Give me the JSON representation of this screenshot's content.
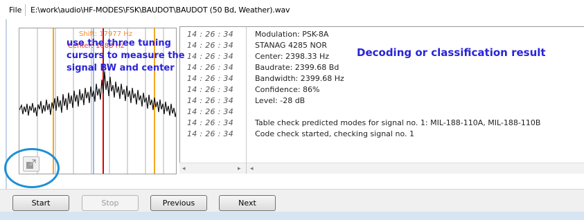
{
  "file_bar": {
    "menu_label": "File",
    "path": "E:\\work\\audio\\HF-MODES\\FSK\\BAUDOT\\BAUDOT (50 Bd, Weather).wav"
  },
  "spectrum": {
    "shift_label": "Shift: 17977 Hz",
    "center_label": "Center: 1088 Hz",
    "annotation": "use the three tuning\ncursors to measure the\nsignal BW and center",
    "colors": {
      "shift_cursor": "#f5a623",
      "center_cursor": "#e00000",
      "signal": "#000000"
    }
  },
  "log": {
    "rows": [
      {
        "time": "14 : 26 : 34",
        "message": "Modulation: PSK-8A"
      },
      {
        "time": "14 : 26 : 34",
        "message": "STANAG 4285 NOR"
      },
      {
        "time": "14 : 26 : 34",
        "message": "Center: 2398.33 Hz"
      },
      {
        "time": "14 : 26 : 34",
        "message": "Baudrate: 2399.68 Bd"
      },
      {
        "time": "14 : 26 : 34",
        "message": "Bandwidth: 2399.68 Hz"
      },
      {
        "time": "14 : 26 : 34",
        "message": "Confidence: 86%"
      },
      {
        "time": "14 : 26 : 34",
        "message": "Level: -28 dB"
      },
      {
        "time": "14 : 26 : 34",
        "message": ""
      },
      {
        "time": "14 : 26 : 34",
        "message": "Table check predicted modes for signal no. 1: MIL-188-110A, MIL-188-110B"
      },
      {
        "time": "14 : 26 : 34",
        "message": " Code check started, checking signal no. 1"
      }
    ],
    "result_annotation": "Decoding or classification result"
  },
  "buttons": {
    "start": "Start",
    "stop": "Stop",
    "previous": "Previous",
    "next": "Next"
  },
  "icons": {
    "popout": "popout-arrow-icon",
    "highlight_color": "#1e8fd6"
  }
}
